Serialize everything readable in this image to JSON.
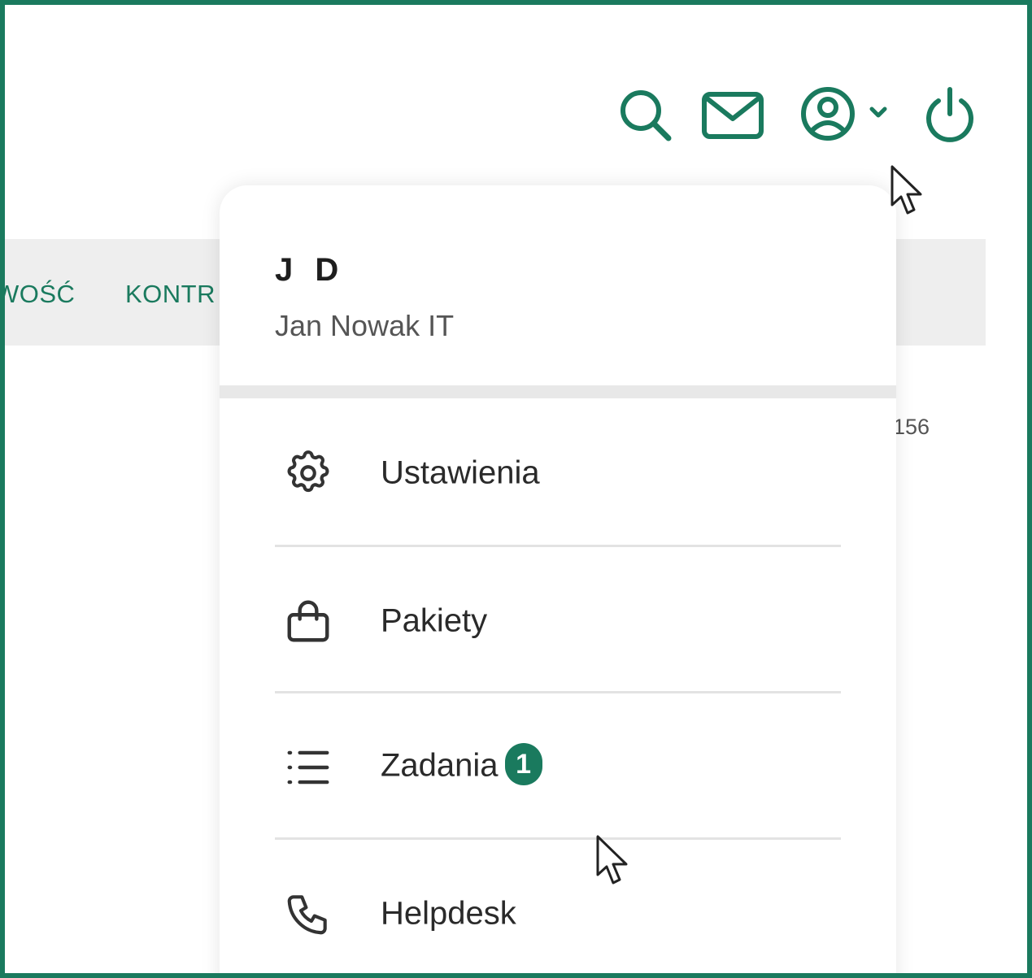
{
  "header": {
    "icons": [
      "search-icon",
      "mail-icon",
      "user-circle-icon",
      "chevron-down-icon",
      "power-icon"
    ]
  },
  "nav": {
    "items": [
      {
        "label": "WOŚĆ"
      },
      {
        "label": "KONTR"
      }
    ]
  },
  "background": {
    "number_fragment": "156"
  },
  "user_menu": {
    "initials": "J D",
    "company": "Jan Nowak IT",
    "items": [
      {
        "label": "Ustawienia",
        "icon": "gear-icon"
      },
      {
        "label": "Pakiety",
        "icon": "shopping-bag-icon"
      },
      {
        "label": "Zadania",
        "icon": "list-icon",
        "badge": "1"
      },
      {
        "label": "Helpdesk",
        "icon": "phone-icon"
      }
    ]
  },
  "colors": {
    "accent": "#1a7a5e",
    "frame_border": "#1a7a5e",
    "navbar_bg": "#eeeeee",
    "text_dark": "#2a2a2a",
    "text_muted": "#555555"
  }
}
